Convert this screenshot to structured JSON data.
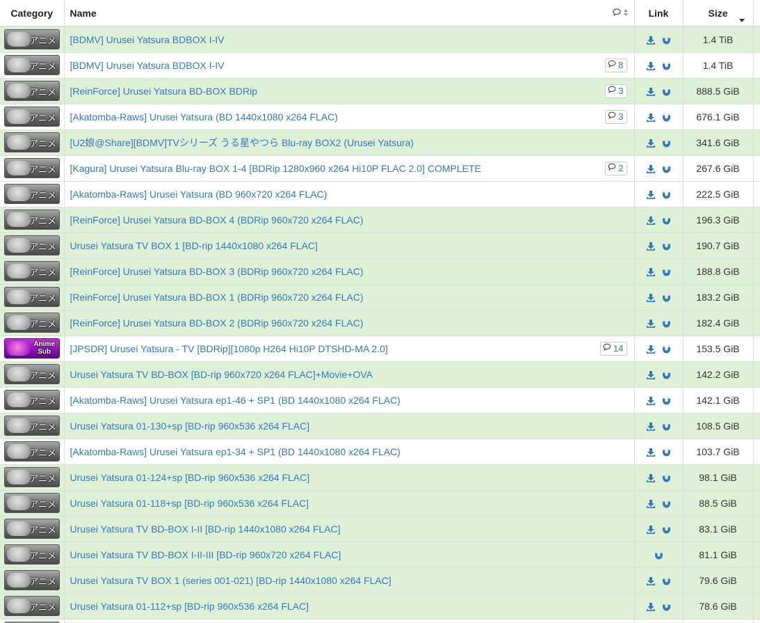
{
  "headers": {
    "category": "Category",
    "name": "Name",
    "link": "Link",
    "size": "Size"
  },
  "colors": {
    "success_row": "#dff0d8",
    "default_row": "#ffffff",
    "link": "#337ab7"
  },
  "rows": [
    {
      "category": "アニメ",
      "category_type": "anime",
      "name": "[BDMV] Urusei Yatsura BDBOX I-IV",
      "comments": null,
      "download": true,
      "magnet": true,
      "size": "1.4 TiB",
      "style": "success"
    },
    {
      "category": "アニメ",
      "category_type": "anime",
      "name": "[BDMV] Urusei Yatsura BDBOX I-IV",
      "comments": "8",
      "download": true,
      "magnet": true,
      "size": "1.4 TiB",
      "style": "default"
    },
    {
      "category": "アニメ",
      "category_type": "anime",
      "name": "[ReinForce] Urusei Yatsura BD-BOX BDRip",
      "comments": "3",
      "download": true,
      "magnet": true,
      "size": "888.5 GiB",
      "style": "success"
    },
    {
      "category": "アニメ",
      "category_type": "anime",
      "name": "[Akatomba-Raws] Urusei Yatsura (BD 1440x1080 x264 FLAC)",
      "comments": "3",
      "download": true,
      "magnet": true,
      "size": "676.1 GiB",
      "style": "default"
    },
    {
      "category": "アニメ",
      "category_type": "anime",
      "name": "[U2娘@Share][BDMV]TVシリーズ うる星やつら Blu-ray BOX2 (Urusei Yatsura)",
      "comments": null,
      "download": true,
      "magnet": true,
      "size": "341.6 GiB",
      "style": "success"
    },
    {
      "category": "アニメ",
      "category_type": "anime",
      "name": "[Kagura] Urusei Yatsura Blu-ray BOX 1-4 [BDRip 1280x960 x264 Hi10P FLAC 2.0] COMPLETE",
      "comments": "2",
      "download": true,
      "magnet": true,
      "size": "267.6 GiB",
      "style": "default"
    },
    {
      "category": "アニメ",
      "category_type": "anime",
      "name": "[Akatomba-Raws] Urusei Yatsura (BD 960x720 x264 FLAC)",
      "comments": null,
      "download": true,
      "magnet": true,
      "size": "222.5 GiB",
      "style": "default"
    },
    {
      "category": "アニメ",
      "category_type": "anime",
      "name": "[ReinForce] Urusei Yatsura BD-BOX 4 (BDRip 960x720 x264 FLAC)",
      "comments": null,
      "download": true,
      "magnet": true,
      "size": "196.3 GiB",
      "style": "success"
    },
    {
      "category": "アニメ",
      "category_type": "anime",
      "name": "Urusei Yatsura TV BOX 1 [BD-rip 1440x1080 x264 FLAC]",
      "comments": null,
      "download": true,
      "magnet": true,
      "size": "190.7 GiB",
      "style": "success"
    },
    {
      "category": "アニメ",
      "category_type": "anime",
      "name": "[ReinForce] Urusei Yatsura BD-BOX 3 (BDRip 960x720 x264 FLAC)",
      "comments": null,
      "download": true,
      "magnet": true,
      "size": "188.8 GiB",
      "style": "success"
    },
    {
      "category": "アニメ",
      "category_type": "anime",
      "name": "[ReinForce] Urusei Yatsura BD-BOX 1 (BDRip 960x720 x264 FLAC)",
      "comments": null,
      "download": true,
      "magnet": true,
      "size": "183.2 GiB",
      "style": "success"
    },
    {
      "category": "アニメ",
      "category_type": "anime",
      "name": "[ReinForce] Urusei Yatsura BD-BOX 2 (BDRip 960x720 x264 FLAC)",
      "comments": null,
      "download": true,
      "magnet": true,
      "size": "182.4 GiB",
      "style": "success"
    },
    {
      "category": "Anime Sub",
      "category_type": "sub",
      "name": "[JPSDR] Urusei Yatsura - TV [BDRip][1080p H264 Hi10P DTSHD-MA 2.0]",
      "comments": "14",
      "download": true,
      "magnet": true,
      "size": "153.5 GiB",
      "style": "default"
    },
    {
      "category": "アニメ",
      "category_type": "anime",
      "name": "Urusei Yatsura TV BD-BOX [BD-rip 960x720 x264 FLAC]+Movie+OVA",
      "comments": null,
      "download": true,
      "magnet": true,
      "size": "142.2 GiB",
      "style": "success"
    },
    {
      "category": "アニメ",
      "category_type": "anime",
      "name": "[Akatomba-Raws] Urusei Yatsura ep1-46 + SP1 (BD 1440x1080 x264 FLAC)",
      "comments": null,
      "download": true,
      "magnet": true,
      "size": "142.1 GiB",
      "style": "default"
    },
    {
      "category": "アニメ",
      "category_type": "anime",
      "name": "Urusei Yatsura 01-130+sp [BD-rip 960x536 x264 FLAC]",
      "comments": null,
      "download": true,
      "magnet": true,
      "size": "108.5 GiB",
      "style": "success"
    },
    {
      "category": "アニメ",
      "category_type": "anime",
      "name": "[Akatomba-Raws] Urusei Yatsura ep1-34 + SP1 (BD 1440x1080 x264 FLAC)",
      "comments": null,
      "download": true,
      "magnet": true,
      "size": "103.7 GiB",
      "style": "default"
    },
    {
      "category": "アニメ",
      "category_type": "anime",
      "name": "Urusei Yatsura 01-124+sp [BD-rip 960x536 x264 FLAC]",
      "comments": null,
      "download": true,
      "magnet": true,
      "size": "98.1 GiB",
      "style": "success"
    },
    {
      "category": "アニメ",
      "category_type": "anime",
      "name": "Urusei Yatsura 01-118+sp [BD-rip 960x536 x264 FLAC]",
      "comments": null,
      "download": true,
      "magnet": true,
      "size": "88.5 GiB",
      "style": "success"
    },
    {
      "category": "アニメ",
      "category_type": "anime",
      "name": "Urusei Yatsura TV BD-BOX I-II [BD-rip 1440x1080 x264 FLAC]",
      "comments": null,
      "download": true,
      "magnet": true,
      "size": "83.1 GiB",
      "style": "success"
    },
    {
      "category": "アニメ",
      "category_type": "anime",
      "name": "Urusei Yatsura TV BD-BOX I-II-III [BD-rip 960x720 x264 FLAC]",
      "comments": null,
      "download": false,
      "magnet": true,
      "size": "81.1 GiB",
      "style": "success"
    },
    {
      "category": "アニメ",
      "category_type": "anime",
      "name": "Urusei Yatsura TV BOX 1 (series 001-021) [BD-rip 1440x1080 x264 FLAC]",
      "comments": null,
      "download": true,
      "magnet": true,
      "size": "79.6 GiB",
      "style": "success"
    },
    {
      "category": "アニメ",
      "category_type": "anime",
      "name": "Urusei Yatsura 01-112+sp [BD-rip 960x536 x264 FLAC]",
      "comments": null,
      "download": true,
      "magnet": true,
      "size": "78.6 GiB",
      "style": "success"
    },
    {
      "category": "アニメ",
      "category_type": "anime",
      "name": "",
      "comments": null,
      "download": false,
      "magnet": false,
      "size": "",
      "style": "default"
    }
  ]
}
